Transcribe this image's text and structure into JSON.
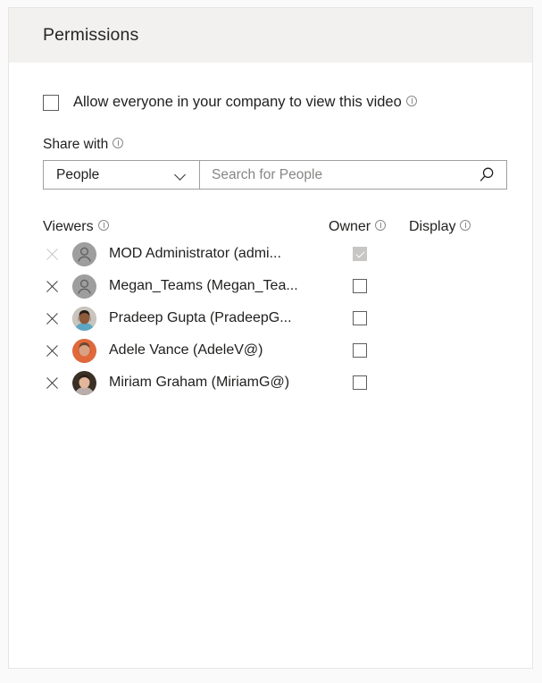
{
  "card": {
    "header_title": "Permissions"
  },
  "allow_everyone": {
    "label": "Allow everyone in your company to view this video",
    "checked": false,
    "info_icon": "info-icon"
  },
  "share_with": {
    "label": "Share with",
    "info_icon": "info-icon",
    "select_value": "People",
    "select_options": [
      "People"
    ],
    "chevron_icon": "chevron-down-icon",
    "search_value": "",
    "search_placeholder": "Search for People",
    "search_icon": "search-icon"
  },
  "table": {
    "columns": [
      {
        "key": "viewers",
        "label": "Viewers",
        "info_icon": "info-icon"
      },
      {
        "key": "owner",
        "label": "Owner",
        "info_icon": "info-icon"
      },
      {
        "key": "display",
        "label": "Display",
        "info_icon": "info-icon"
      }
    ],
    "rows": [
      {
        "name": "MOD Administrator (admi...",
        "avatar_type": "placeholder",
        "avatar_bg": "#9e9e9e",
        "owner_checked": true,
        "owner_disabled": true,
        "remove_disabled": true,
        "remove_icon": "close-icon"
      },
      {
        "name": "Megan_Teams (Megan_Tea...",
        "avatar_type": "placeholder",
        "avatar_bg": "#9e9e9e",
        "owner_checked": false,
        "owner_disabled": false,
        "remove_disabled": false,
        "remove_icon": "close-icon"
      },
      {
        "name": "Pradeep Gupta (PradeepG...",
        "avatar_type": "photo",
        "avatar_bg": "#c9c4bd",
        "avatar_skin": "#8d5a3b",
        "avatar_hair": "#231a14",
        "avatar_shirt": "#5da7c4",
        "owner_checked": false,
        "owner_disabled": false,
        "remove_disabled": false,
        "remove_icon": "close-icon"
      },
      {
        "name": "Adele Vance (AdeleV@)",
        "avatar_type": "photo",
        "avatar_bg": "#e0683a",
        "avatar_skin": "#d9a183",
        "avatar_hair": "#6b4530",
        "avatar_shirt": "#e0683a",
        "owner_checked": false,
        "owner_disabled": false,
        "remove_disabled": false,
        "remove_icon": "close-icon"
      },
      {
        "name": "Miriam Graham (MiriamG@)",
        "avatar_type": "photo",
        "avatar_bg": "#3b3026",
        "avatar_skin": "#e3b79b",
        "avatar_hair": "#2e231b",
        "avatar_shirt": "#b8adab",
        "owner_checked": false,
        "owner_disabled": false,
        "remove_disabled": false,
        "remove_icon": "close-icon"
      }
    ]
  },
  "colors": {
    "header_bg": "#f2f1f0",
    "card_bg": "#ffffff",
    "page_bg": "#fafafa",
    "border": "#e6e6e6",
    "text": "#201f1e",
    "placeholder": "#888684"
  }
}
